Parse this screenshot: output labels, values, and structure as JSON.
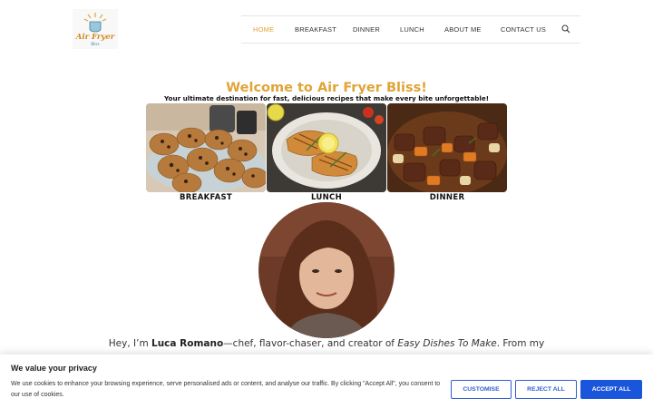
{
  "logo": {
    "text_line1": "Air Fryer",
    "text_line2": "Bliss"
  },
  "nav": {
    "items": [
      {
        "label": "HOME",
        "active": true
      },
      {
        "label": "BREAKFAST",
        "active": false
      },
      {
        "label": "DINNER",
        "active": false
      },
      {
        "label": "LUNCH",
        "active": false
      },
      {
        "label": "ABOUT ME",
        "active": false
      },
      {
        "label": "CONTACT US",
        "active": false
      }
    ],
    "search_icon": "search-icon"
  },
  "hero": {
    "title": "Welcome to Air Fryer Bliss!",
    "subtitle": "Your ultimate destination for fast, delicious recipes that make every bite unforgettable!"
  },
  "categories": [
    {
      "label": "BREAKFAST",
      "image": "chocolate-chip-cookies"
    },
    {
      "label": "LUNCH",
      "image": "grilled-chicken-with-lemon"
    },
    {
      "label": "DINNER",
      "image": "beef-stew"
    }
  ],
  "intro": {
    "prefix": "Hey, I’m ",
    "name": "Luca Romano",
    "middle": "—chef, flavor-chaser, and creator of ",
    "site": "Easy Dishes To Make",
    "suffix": ". From my"
  },
  "cookie": {
    "title": "We value your privacy",
    "text": "We use cookies to enhance your browsing experience, serve personalised ads or content, and analyse our traffic. By clicking \"Accept All\", you consent to our use of cookies.",
    "customise": "CUSTOMISE",
    "reject": "REJECT ALL",
    "accept": "ACCEPT ALL"
  },
  "colors": {
    "accent": "#e0a437",
    "button_blue": "#1a56db"
  }
}
